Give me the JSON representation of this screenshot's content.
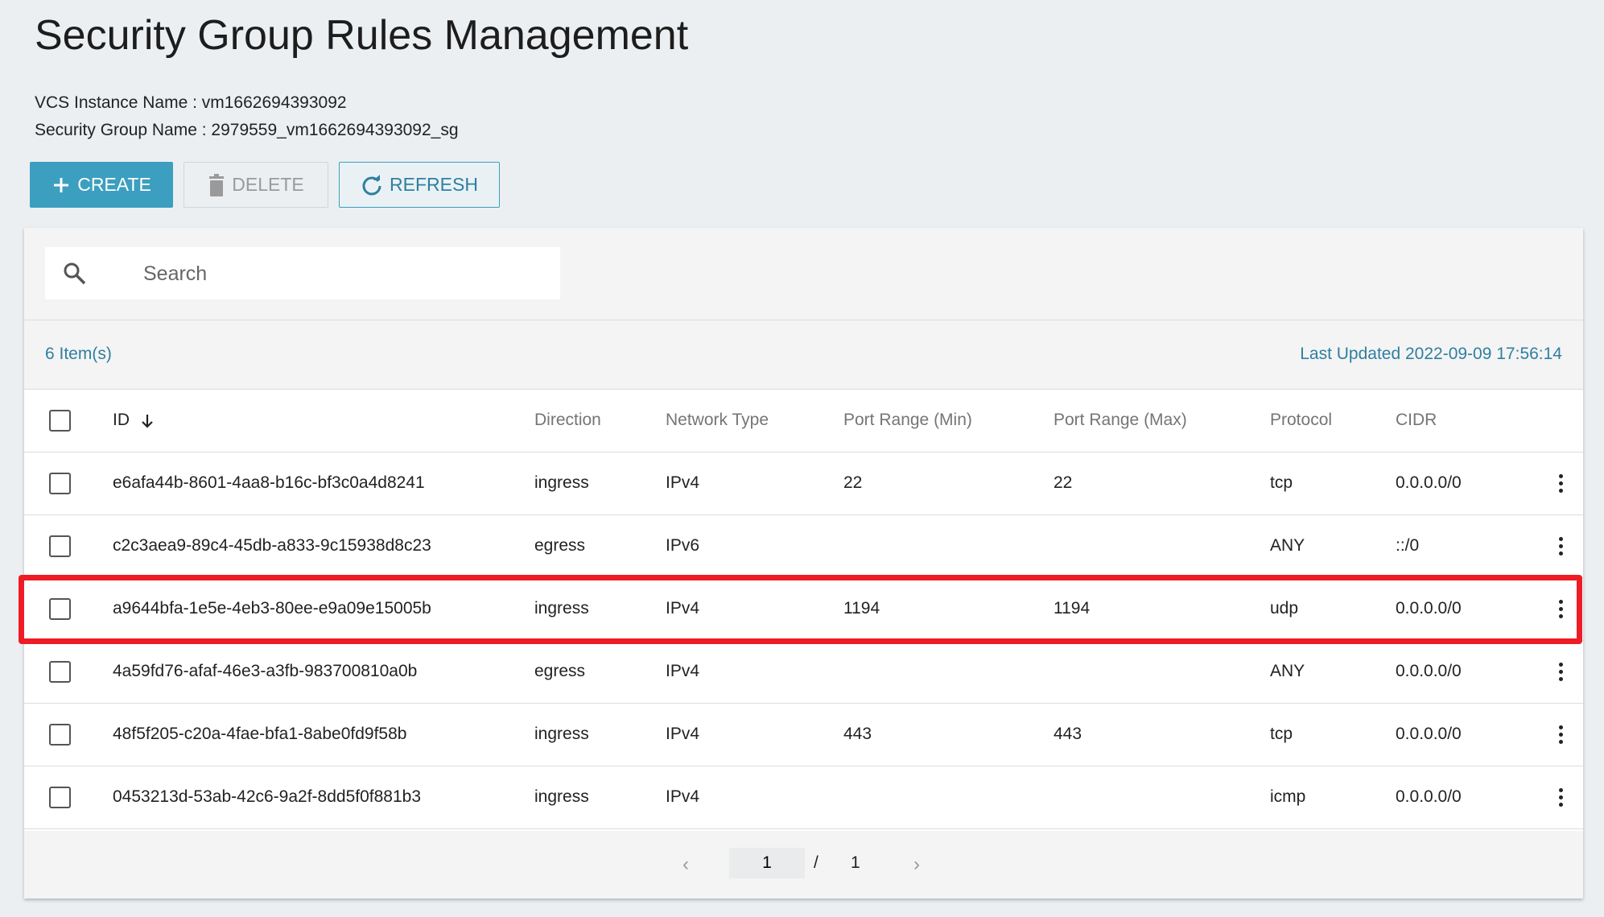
{
  "page": {
    "title": "Security Group Rules Management",
    "instance_line": "VCS Instance Name : vm1662694393092",
    "group_line": "Security Group Name : 2979559_vm1662694393092_sg"
  },
  "toolbar": {
    "create_label": "CREATE",
    "delete_label": "DELETE",
    "refresh_label": "REFRESH"
  },
  "search": {
    "placeholder": "Search",
    "value": ""
  },
  "summary": {
    "item_count": "6 Item(s)",
    "last_updated": "Last Updated 2022-09-09 17:56:14"
  },
  "table": {
    "columns": [
      "ID",
      "Direction",
      "Network Type",
      "Port Range (Min)",
      "Port Range (Max)",
      "Protocol",
      "CIDR"
    ],
    "rows": [
      {
        "id": "e6afa44b-8601-4aa8-b16c-bf3c0a4d8241",
        "direction": "ingress",
        "network_type": "IPv4",
        "port_min": "22",
        "port_max": "22",
        "protocol": "tcp",
        "cidr": "0.0.0.0/0"
      },
      {
        "id": "c2c3aea9-89c4-45db-a833-9c15938d8c23",
        "direction": "egress",
        "network_type": "IPv6",
        "port_min": "",
        "port_max": "",
        "protocol": "ANY",
        "cidr": "::/0"
      },
      {
        "id": "a9644bfa-1e5e-4eb3-80ee-e9a09e15005b",
        "direction": "ingress",
        "network_type": "IPv4",
        "port_min": "1194",
        "port_max": "1194",
        "protocol": "udp",
        "cidr": "0.0.0.0/0"
      },
      {
        "id": "4a59fd76-afaf-46e3-a3fb-983700810a0b",
        "direction": "egress",
        "network_type": "IPv4",
        "port_min": "",
        "port_max": "",
        "protocol": "ANY",
        "cidr": "0.0.0.0/0"
      },
      {
        "id": "48f5f205-c20a-4fae-bfa1-8abe0fd9f58b",
        "direction": "ingress",
        "network_type": "IPv4",
        "port_min": "443",
        "port_max": "443",
        "protocol": "tcp",
        "cidr": "0.0.0.0/0"
      },
      {
        "id": "0453213d-53ab-42c6-9a2f-8dd5f0f881b3",
        "direction": "ingress",
        "network_type": "IPv4",
        "port_min": "",
        "port_max": "",
        "protocol": "icmp",
        "cidr": "0.0.0.0/0"
      }
    ]
  },
  "pagination": {
    "prev": "‹",
    "current": "1",
    "separator": "/",
    "total": "1",
    "next": "›"
  },
  "colors": {
    "accent": "#3c9fbf",
    "link": "#2f7fa0",
    "highlight": "#ee1c25"
  },
  "icons": {
    "create": "plus-icon",
    "delete": "trash-icon",
    "refresh": "refresh-icon",
    "search": "search-icon",
    "sort": "arrow-down-icon",
    "row_menu": "more-vertical-icon"
  }
}
